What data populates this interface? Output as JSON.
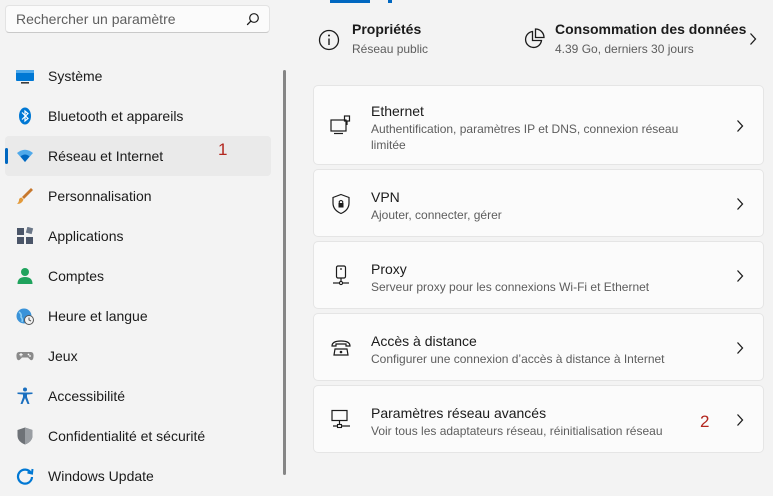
{
  "search": {
    "placeholder": "Rechercher un paramètre"
  },
  "sidebar": {
    "items": [
      {
        "label": "Système",
        "icon": "monitor-icon"
      },
      {
        "label": "Bluetooth et appareils",
        "icon": "bluetooth-icon"
      },
      {
        "label": "Réseau et Internet",
        "icon": "wifi-icon",
        "selected": true
      },
      {
        "label": "Personnalisation",
        "icon": "brush-icon"
      },
      {
        "label": "Applications",
        "icon": "apps-icon"
      },
      {
        "label": "Comptes",
        "icon": "person-icon"
      },
      {
        "label": "Heure et langue",
        "icon": "clock-globe-icon"
      },
      {
        "label": "Jeux",
        "icon": "gamepad-icon"
      },
      {
        "label": "Accessibilité",
        "icon": "accessibility-icon"
      },
      {
        "label": "Confidentialité et sécurité",
        "icon": "shield-icon"
      },
      {
        "label": "Windows Update",
        "icon": "update-icon"
      }
    ],
    "annotation": "1"
  },
  "header": {
    "properties": {
      "title": "Propriétés",
      "subtitle": "Réseau public",
      "icon": "info-icon"
    },
    "data_usage": {
      "title": "Consommation des données",
      "subtitle": "4.39 Go, derniers 30 jours",
      "icon": "pie-chart-icon"
    }
  },
  "cards": [
    {
      "title": "Ethernet",
      "description": "Authentification, paramètres IP et DNS, connexion réseau limitée",
      "icon": "ethernet-icon"
    },
    {
      "title": "VPN",
      "description": "Ajouter, connecter, gérer",
      "icon": "vpn-shield-icon"
    },
    {
      "title": "Proxy",
      "description": "Serveur proxy pour les connexions Wi-Fi et Ethernet",
      "icon": "proxy-icon"
    },
    {
      "title": "Accès à distance",
      "description": "Configurer une connexion d’accès à distance à Internet",
      "icon": "dialup-icon"
    },
    {
      "title": "Paramètres réseau avancés",
      "description": "Voir tous les adaptateurs réseau, réinitialisation réseau",
      "icon": "network-computer-icon",
      "annotation": "2"
    }
  ],
  "colors": {
    "accent": "#0067c0",
    "annotation": "#b3261e",
    "background": "#f3f3f3",
    "card": "#fbfbfb"
  }
}
